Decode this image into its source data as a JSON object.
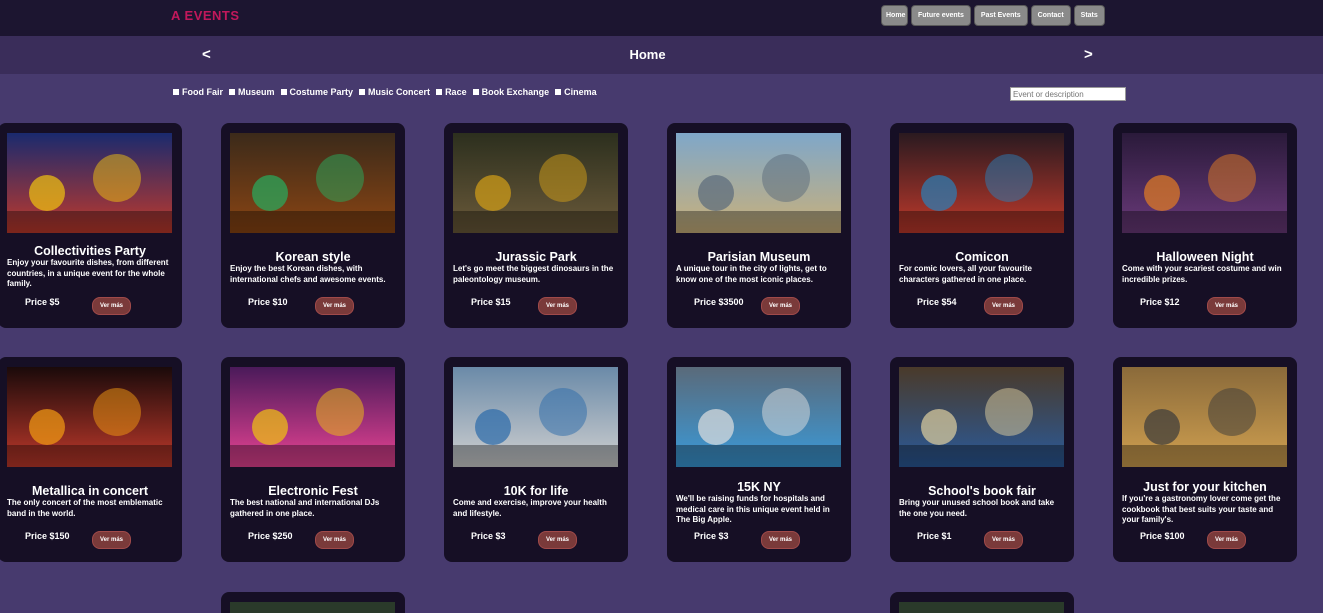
{
  "header": {
    "logo_text": "A EVENTS",
    "nav": [
      "Home",
      "Future events",
      "Past Events",
      "Contact",
      "Stats"
    ]
  },
  "pagebar": {
    "prev": "<",
    "title": "Home",
    "next": ">"
  },
  "filters": [
    "Food Fair",
    "Museum",
    "Costume Party",
    "Music Concert",
    "Race",
    "Book Exchange",
    "Cinema"
  ],
  "search": {
    "placeholder": "Event or description"
  },
  "button_label": "Ver más",
  "events": [
    {
      "title": "Collectivities Party",
      "desc": "Enjoy your favourite dishes, from different countries, in a unique event for the whole family.",
      "price": "Price $5"
    },
    {
      "title": "Korean style",
      "desc": "Enjoy the best Korean dishes, with international chefs and awesome events.",
      "price": "Price $10"
    },
    {
      "title": "Jurassic Park",
      "desc": "Let's go meet the biggest dinosaurs in the paleontology museum.",
      "price": "Price $15"
    },
    {
      "title": "Parisian Museum",
      "desc": "A unique tour in the city of lights, get to know one of the most iconic places.",
      "price": "Price $3500"
    },
    {
      "title": "Comicon",
      "desc": "For comic lovers, all your favourite characters gathered in one place.",
      "price": "Price $54"
    },
    {
      "title": "Halloween Night",
      "desc": "Come with your scariest costume and win incredible prizes.",
      "price": "Price $12"
    },
    {
      "title": "Metallica in concert",
      "desc": "The only concert of the most emblematic band in the world.",
      "price": "Price $150"
    },
    {
      "title": "Electronic Fest",
      "desc": "The best national and international DJs gathered in one place.",
      "price": "Price $250"
    },
    {
      "title": "10K for life",
      "desc": "Come and exercise, improve your health and lifestyle.",
      "price": "Price $3"
    },
    {
      "title": "15K NY",
      "desc": "We'll be raising funds for hospitals and medical care in this unique event held in The Big Apple.",
      "price": "Price $3"
    },
    {
      "title": "School's book fair",
      "desc": "Bring your unused school book and take the one you need.",
      "price": "Price $1"
    },
    {
      "title": "Just for your kitchen",
      "desc": "If you're a gastronomy lover come get the cookbook that best suits your taste and your family's.",
      "price": "Price $100"
    }
  ]
}
